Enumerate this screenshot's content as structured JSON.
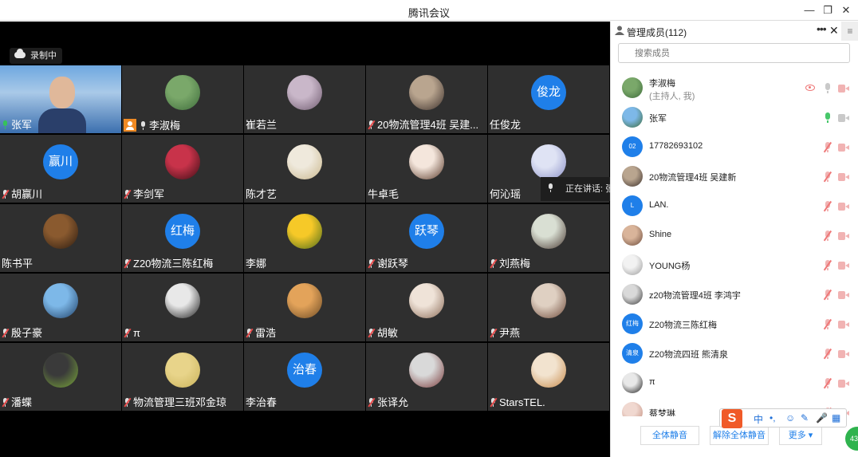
{
  "window": {
    "title": "腾讯会议",
    "controls": [
      "minimize-icon",
      "restore-icon",
      "close-icon"
    ]
  },
  "recording": {
    "label": "录制中",
    "icon": "cloud-icon"
  },
  "speaking": {
    "label": "正在讲话: 张军;"
  },
  "tiles": [
    {
      "name": "张军",
      "mic": "active",
      "type": "video"
    },
    {
      "name": "李淑梅",
      "mic": "on",
      "host": true,
      "type": "photo",
      "palette": [
        "#7aa86a",
        "#3d6b3a"
      ]
    },
    {
      "name": "崔若兰",
      "mic": "none",
      "type": "photo",
      "palette": [
        "#c9b7c9",
        "#6e5a6e"
      ]
    },
    {
      "name": "20物流管理4班 吴建...",
      "mic": "muted",
      "type": "photo",
      "palette": [
        "#b9a58f",
        "#3b2f2b"
      ]
    },
    {
      "name": "任俊龙",
      "mic": "none",
      "type": "text",
      "avatar_text": "俊龙"
    },
    {
      "name": "胡赢川",
      "mic": "muted",
      "type": "text",
      "avatar_text": "赢川"
    },
    {
      "name": "李剑军",
      "mic": "muted",
      "type": "photo",
      "palette": [
        "#c8334a",
        "#3a0d14"
      ]
    },
    {
      "name": "陈才艺",
      "mic": "none",
      "type": "photo",
      "palette": [
        "#efe9dc",
        "#c9b68c"
      ]
    },
    {
      "name": "牛卓毛",
      "mic": "none",
      "type": "photo",
      "palette": [
        "#f4e6dc",
        "#5a3a2a"
      ]
    },
    {
      "name": "何沁瑶",
      "mic": "none",
      "type": "photo",
      "palette": [
        "#dfe3f4",
        "#8a8fc6"
      ]
    },
    {
      "name": "陈书平",
      "mic": "none",
      "type": "photo",
      "palette": [
        "#8a5a2f",
        "#2b1b10"
      ]
    },
    {
      "name": "Z20物流三陈红梅",
      "mic": "muted",
      "type": "text",
      "avatar_text": "红梅"
    },
    {
      "name": "李娜",
      "mic": "none",
      "type": "photo",
      "palette": [
        "#f6c928",
        "#4a6a1a"
      ]
    },
    {
      "name": "谢跃琴",
      "mic": "muted",
      "type": "text",
      "avatar_text": "跃琴"
    },
    {
      "name": "刘燕梅",
      "mic": "muted",
      "type": "photo",
      "palette": [
        "#d9dfd3",
        "#4a3a33"
      ]
    },
    {
      "name": "殷子豪",
      "mic": "muted",
      "type": "photo",
      "palette": [
        "#7db8e8",
        "#1f3f66"
      ]
    },
    {
      "name": "π",
      "mic": "muted",
      "type": "photo",
      "palette": [
        "#e8e8e8",
        "#1b1b1b"
      ]
    },
    {
      "name": "雷浩",
      "mic": "muted",
      "type": "photo",
      "palette": [
        "#e3a35a",
        "#6b4a24"
      ]
    },
    {
      "name": "胡敏",
      "mic": "muted",
      "type": "photo",
      "palette": [
        "#efe3d8",
        "#8a6a56"
      ]
    },
    {
      "name": "尹燕",
      "mic": "muted",
      "type": "photo",
      "palette": [
        "#dfd0c2",
        "#6e4a3a"
      ]
    },
    {
      "name": "潘蝶",
      "mic": "muted",
      "type": "photo",
      "palette": [
        "#3a3a3a",
        "#7aa83a"
      ]
    },
    {
      "name": "物流管理三班邓金琼",
      "mic": "muted",
      "type": "photo",
      "palette": [
        "#e8d48a",
        "#c9b25a"
      ]
    },
    {
      "name": "李治春",
      "mic": "none",
      "type": "text",
      "avatar_text": "治春"
    },
    {
      "name": "张译允",
      "mic": "muted",
      "type": "photo",
      "palette": [
        "#d9d9d9",
        "#7a3a3a"
      ]
    },
    {
      "name": "StarsTEL.",
      "mic": "muted",
      "type": "photo",
      "palette": [
        "#f2e3cf",
        "#c78a4a"
      ]
    }
  ],
  "panel": {
    "title": "管理成员(112)",
    "search_placeholder": "搜索成员",
    "members": [
      {
        "name": "李淑梅",
        "sub": "(主持人, 我)",
        "avatar": "photo",
        "palette": [
          "#7aa86a",
          "#3d6b3a"
        ],
        "mic": "off-grey",
        "cam": "muted",
        "eye": true
      },
      {
        "name": "张军",
        "avatar": "photo",
        "palette": [
          "#7db8e8",
          "#3b6b3a"
        ],
        "mic": "on",
        "cam": "off"
      },
      {
        "name": "17782693102",
        "avatar": "text",
        "avatar_text": "02",
        "mic": "muted",
        "cam": "muted"
      },
      {
        "name": "20物流管理4班 吴建新",
        "avatar": "photo",
        "palette": [
          "#b9a58f",
          "#3b2f2b"
        ],
        "mic": "muted",
        "cam": "muted"
      },
      {
        "name": "LAN.",
        "avatar": "text",
        "avatar_text": "L",
        "mic": "muted",
        "cam": "muted"
      },
      {
        "name": "Shine",
        "avatar": "photo",
        "palette": [
          "#d9b49a",
          "#6b4a3a"
        ],
        "mic": "muted",
        "cam": "muted"
      },
      {
        "name": "YOUNG杨",
        "avatar": "photo",
        "palette": [
          "#f2f2f2",
          "#9a9a9a"
        ],
        "mic": "muted",
        "cam": "muted"
      },
      {
        "name": "z20物流管理4班 李鸿宇",
        "avatar": "photo",
        "palette": [
          "#d9d9d9",
          "#3a3a3a"
        ],
        "mic": "muted",
        "cam": "muted"
      },
      {
        "name": "Z20物流三陈红梅",
        "avatar": "text",
        "avatar_text": "红梅",
        "mic": "muted",
        "cam": "muted"
      },
      {
        "name": "Z20物流四班 熊清泉",
        "avatar": "text",
        "avatar_text": "清泉",
        "mic": "muted",
        "cam": "muted"
      },
      {
        "name": "π",
        "avatar": "photo",
        "palette": [
          "#e8e8e8",
          "#1b1b1b"
        ],
        "mic": "muted",
        "cam": "muted"
      },
      {
        "name": "蔡梦琳",
        "avatar": "photo",
        "palette": [
          "#f0d8d0",
          "#c08a7a"
        ],
        "mic": "muted",
        "cam": "muted"
      }
    ],
    "footer": {
      "mute_all": "全体静音",
      "unmute_all": "解除全体静音",
      "more": "更多 ▾"
    }
  },
  "ime": {
    "logo": "S",
    "chars": [
      "中",
      "•,",
      "☺",
      "✎",
      "🎤",
      "▦"
    ]
  },
  "badge_count": "43",
  "colors": {
    "accent": "#1f7fe9",
    "tile_bg": "#2f2f2f",
    "muted_red": "#e64b4b",
    "active_green": "#36c25a"
  }
}
